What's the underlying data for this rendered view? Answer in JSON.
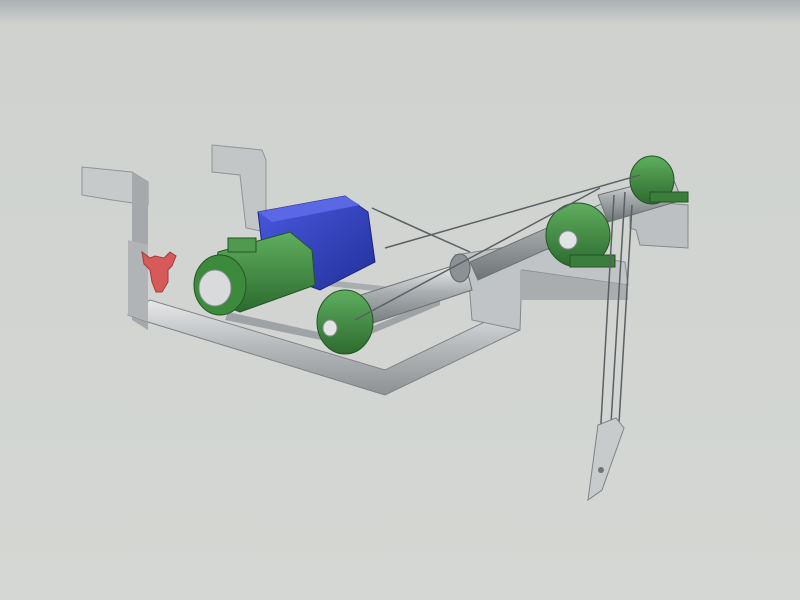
{
  "scene": {
    "background_top": "#aab0b4",
    "background": "#d3d6d2",
    "frame_color": "#b8bcbd",
    "motor_color": "#2f3fbf",
    "housing_color": "#3f8a3f",
    "emblem_color": "#d65a5a",
    "shaft_color": "#9aa0a4"
  }
}
